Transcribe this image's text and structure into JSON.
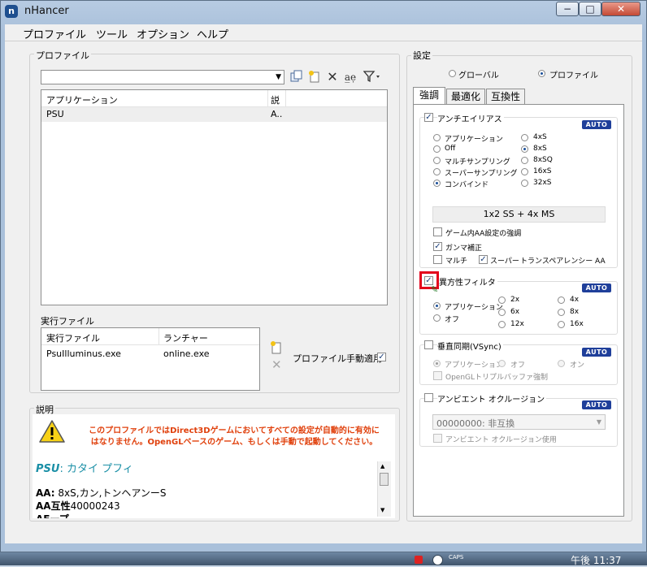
{
  "window": {
    "title": "nHancer",
    "icon_letter": "n",
    "controls": {
      "minimize": "−",
      "maximize": "□",
      "close": "✕"
    }
  },
  "menu": [
    "プロファイル",
    "ツール",
    "オプション",
    "ヘルプ"
  ],
  "profiles": {
    "group_title": "プロファイル",
    "search_value": "",
    "table": {
      "headers": [
        "アプリケーション",
        "説"
      ],
      "rows": [
        [
          "PSU",
          "A.."
        ]
      ]
    }
  },
  "executables": {
    "group_title": "実行ファイル",
    "headers": [
      "実行ファイル",
      "ランチャー"
    ],
    "rows": [
      [
        "PsuIlluminus.exe",
        "online.exe"
      ]
    ],
    "manual_apply_label": "プロファイル手動適用",
    "manual_apply_checked": true
  },
  "description": {
    "group_title": "説明",
    "warning": "このプロファイルではDirect3Dゲームにおいてすべての設定が自動的に有効に\nはなりません。OpenGLベースのゲーム、もしくは手動で起動してください。",
    "profile_name": "PSU",
    "profile_desc": ": カタイ プフィ",
    "line1_label": "AA:",
    "line1_value": " 8xS,カン,トンヘアンーS",
    "line2_label": "AA互性",
    "line2_value": "40000243",
    "line3": "AFープ"
  },
  "settings": {
    "group_title": "設定",
    "scope_global": "グローバル",
    "scope_profile": "プロファイル",
    "scope_selected": "profile",
    "tabs": [
      "強調",
      "最適化",
      "互換性"
    ],
    "active_tab": 0,
    "aa": {
      "title": "アンチエイリアス",
      "checked": true,
      "auto_label": "AUTO",
      "left_options": [
        "アプリケーション",
        "Off",
        "マルチサンプリング",
        "スーパーサンプリング",
        "コンバインド"
      ],
      "right_options": [
        "4xS",
        "8xS",
        "8xSQ",
        "16xS",
        "32xS"
      ],
      "left_selected": 4,
      "right_selected": 1,
      "mode_display": "1x2 SS + 4x MS",
      "ingame_label": "ゲーム内AA設定の強調",
      "ingame_checked": false,
      "gamma_label": "ガンマ補正",
      "gamma_checked": true,
      "multi_label": "マルチ",
      "multi_checked": false,
      "super_label": "スーパー",
      "super_checked": true,
      "transparency_label": "トランスペアレンシー AA"
    },
    "af": {
      "title": "異方性フィルタ",
      "checked": true,
      "auto_label": "AUTO",
      "col1": [
        "アプリケーション",
        "オフ"
      ],
      "col2": [
        "2x",
        "6x",
        "12x"
      ],
      "col3": [
        "4x",
        "8x",
        "16x"
      ],
      "selected": "アプリケーション"
    },
    "vsync": {
      "title": "垂直同期(VSync)",
      "checked": false,
      "auto_label": "AUTO",
      "options": [
        "アプリケーション",
        "オフ",
        "オン"
      ],
      "selected": 0,
      "triple_label": "OpenGLトリプルバッファ強制",
      "triple_checked": false
    },
    "ao": {
      "title": "アンビエント オクルージョン",
      "checked": false,
      "auto_label": "AUTO",
      "combo_value": "00000000: 非互換",
      "use_label": "アンビエント オクルージョン使用",
      "use_checked": false
    }
  },
  "taskbar": {
    "caps": "CAPS",
    "clock": "午後 11:37"
  },
  "colors": {
    "warning_text": "#e0400c",
    "profile_name": "#1a8fa6",
    "auto_badge": "#1f3f9a",
    "highlight_box": "#e3001b"
  }
}
